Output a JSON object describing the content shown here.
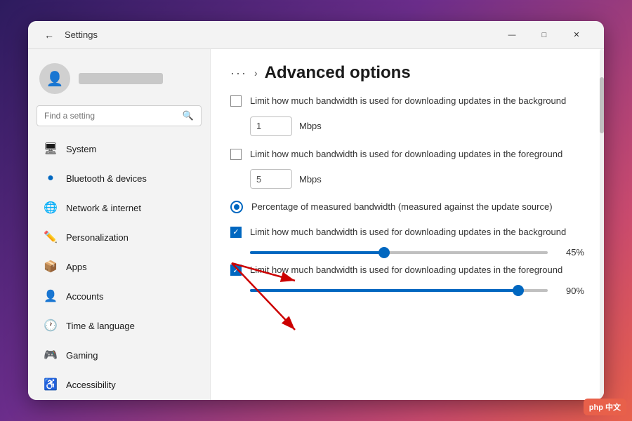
{
  "window": {
    "title": "Settings",
    "back_icon": "←",
    "min_icon": "—",
    "max_icon": "□",
    "close_icon": "✕"
  },
  "header": {
    "dots": "···",
    "arrow": "›",
    "title": "Advanced options"
  },
  "sidebar": {
    "search_placeholder": "Find a setting",
    "nav_items": [
      {
        "id": "system",
        "label": "System",
        "icon": "🖥"
      },
      {
        "id": "bluetooth",
        "label": "Bluetooth & devices",
        "icon": "🔵"
      },
      {
        "id": "network",
        "label": "Network & internet",
        "icon": "🌐"
      },
      {
        "id": "personalization",
        "label": "Personalization",
        "icon": "✏️"
      },
      {
        "id": "apps",
        "label": "Apps",
        "icon": "📦"
      },
      {
        "id": "accounts",
        "label": "Accounts",
        "icon": "👤"
      },
      {
        "id": "time",
        "label": "Time & language",
        "icon": "🕐"
      },
      {
        "id": "gaming",
        "label": "Gaming",
        "icon": "🎮"
      },
      {
        "id": "accessibility",
        "label": "Accessibility",
        "icon": "♿"
      }
    ]
  },
  "settings": {
    "bg_limit_unchecked": "Limit how much bandwidth is used for downloading updates in the background",
    "bg_value": "1",
    "bg_unit": "Mbps",
    "fg_limit_unchecked": "Limit how much bandwidth is used for downloading updates in the foreground",
    "fg_value": "5",
    "fg_unit": "Mbps",
    "radio_label": "Percentage of measured bandwidth (measured against the update source)",
    "bg_limit_checked": "Limit how much bandwidth is used for downloading updates in the background",
    "bg_pct": "45%",
    "fg_limit_checked": "Limit how much bandwidth is used for downloading updates in the foreground",
    "fg_pct": "90%"
  }
}
